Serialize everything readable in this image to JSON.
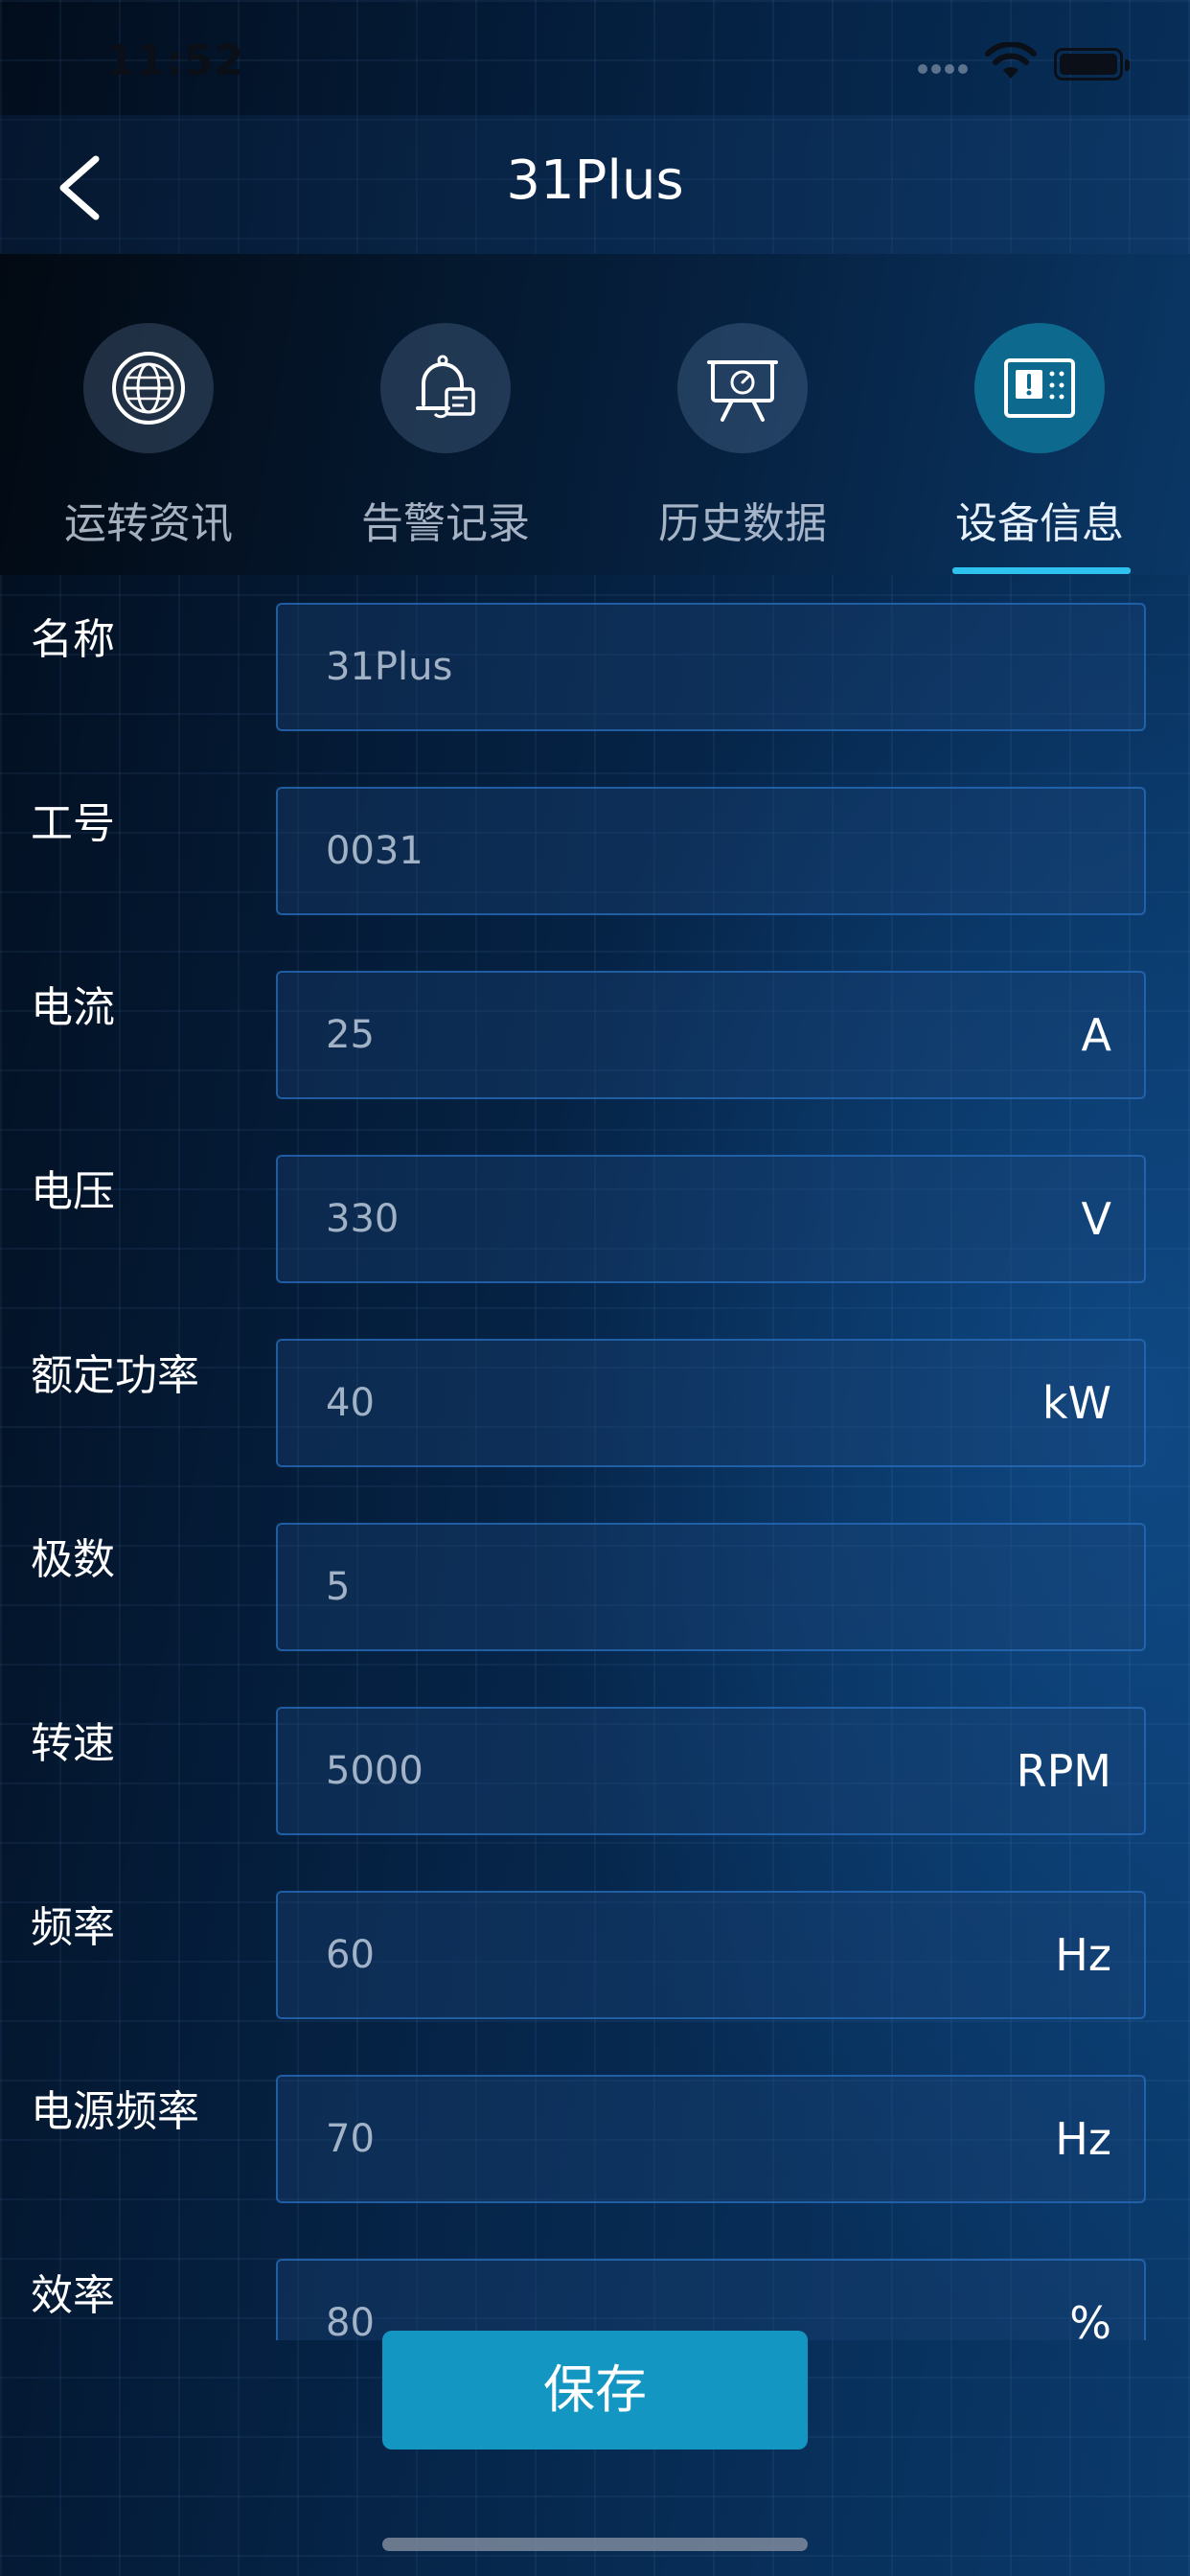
{
  "status_bar": {
    "time": "11:52"
  },
  "header": {
    "title": "31Plus"
  },
  "tabs": [
    {
      "label": "运转资讯",
      "icon": "globe-icon",
      "active": false
    },
    {
      "label": "告警记录",
      "icon": "alarm-bell-icon",
      "active": false
    },
    {
      "label": "历史数据",
      "icon": "presentation-gauge-icon",
      "active": false
    },
    {
      "label": "设备信息",
      "icon": "device-info-icon",
      "active": true
    }
  ],
  "fields": [
    {
      "label": "名称",
      "value": "31Plus",
      "unit": ""
    },
    {
      "label": "工号",
      "value": "0031",
      "unit": ""
    },
    {
      "label": "电流",
      "value": "25",
      "unit": "A"
    },
    {
      "label": "电压",
      "value": "330",
      "unit": "V"
    },
    {
      "label": "额定功率",
      "value": "40",
      "unit": "kW"
    },
    {
      "label": "极数",
      "value": "5",
      "unit": ""
    },
    {
      "label": "转速",
      "value": "5000",
      "unit": "RPM"
    },
    {
      "label": "频率",
      "value": "60",
      "unit": "Hz"
    },
    {
      "label": "电源频率",
      "value": "70",
      "unit": "Hz"
    },
    {
      "label": "效率",
      "value": "80",
      "unit": "%"
    }
  ],
  "actions": {
    "save_label": "保存"
  },
  "colors": {
    "accent": "#1496c3",
    "tab_active_bg": "#0d6a8e",
    "underline": "#2ec2f0"
  }
}
